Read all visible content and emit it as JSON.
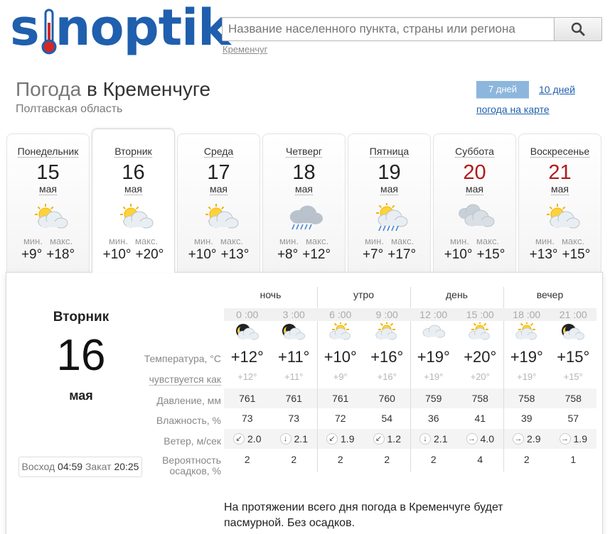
{
  "logo": {
    "text": "sinoptik"
  },
  "search": {
    "placeholder": "Название населенного пункта, страны или региона",
    "recent": "Кременчуг"
  },
  "title": {
    "prefix": "Погода",
    "city": "в Кременчуге",
    "region": "Полтавская область"
  },
  "view_tabs": {
    "seven_days": "7 дней",
    "ten_days": "10 дней",
    "map": "погода на карте"
  },
  "min_label": "мин.",
  "max_label": "макс.",
  "days": [
    {
      "name": "Понедельник",
      "date": "15",
      "month": "мая",
      "min": "+9°",
      "max": "+18°",
      "icon": "partly-cloudy-icon",
      "weekend": false,
      "active": false
    },
    {
      "name": "Вторник",
      "date": "16",
      "month": "мая",
      "min": "+10°",
      "max": "+20°",
      "icon": "partly-cloudy-icon",
      "weekend": false,
      "active": true
    },
    {
      "name": "Среда",
      "date": "17",
      "month": "мая",
      "min": "+10°",
      "max": "+13°",
      "icon": "partly-cloudy-icon",
      "weekend": false,
      "active": false
    },
    {
      "name": "Четверг",
      "date": "18",
      "month": "мая",
      "min": "+8°",
      "max": "+12°",
      "icon": "rain-icon",
      "weekend": false,
      "active": false
    },
    {
      "name": "Пятница",
      "date": "19",
      "month": "мая",
      "min": "+7°",
      "max": "+17°",
      "icon": "sun-rain-icon",
      "weekend": false,
      "active": false
    },
    {
      "name": "Суббота",
      "date": "20",
      "month": "мая",
      "min": "+10°",
      "max": "+15°",
      "icon": "cloudy-icon",
      "weekend": true,
      "active": false
    },
    {
      "name": "Воскресенье",
      "date": "21",
      "month": "мая",
      "min": "+13°",
      "max": "+15°",
      "icon": "partly-cloudy-icon",
      "weekend": true,
      "active": false
    }
  ],
  "detail": {
    "day_name": "Вторник",
    "day_num": "16",
    "month": "мая",
    "sunrise_label": "Восход",
    "sunrise": "04:59",
    "sunset_label": "Закат",
    "sunset": "20:25",
    "periods": [
      "ночь",
      "утро",
      "день",
      "вечер"
    ],
    "times": [
      "0 :00",
      "3 :00",
      "6 :00",
      "9 :00",
      "12 :00",
      "15 :00",
      "18 :00",
      "21 :00"
    ],
    "icons": [
      "moon-cloud-icon",
      "moon-cloud-icon",
      "sun-cloud-icon",
      "sun-cloud-icon",
      "cloud-icon",
      "sun-cloud-icon",
      "sun-cloud-icon",
      "moon-cloud-icon"
    ],
    "labels": {
      "temperature": "Температура, °C",
      "feels": "чувствуется как",
      "pressure": "Давление, мм",
      "humidity": "Влажность, %",
      "wind": "Ветер, м/сек",
      "precip_1": "Вероятность",
      "precip_2": "осадков, %"
    },
    "temperature": [
      "+12°",
      "+11°",
      "+10°",
      "+16°",
      "+19°",
      "+20°",
      "+19°",
      "+15°"
    ],
    "feels": [
      "+12°",
      "+11°",
      "+9°",
      "+16°",
      "+19°",
      "+20°",
      "+19°",
      "+15°"
    ],
    "pressure": [
      "761",
      "761",
      "761",
      "760",
      "759",
      "758",
      "758",
      "758"
    ],
    "humidity": [
      "73",
      "73",
      "72",
      "54",
      "36",
      "41",
      "39",
      "57"
    ],
    "wind_dir": [
      "↙",
      "↓",
      "↙",
      "↙",
      "↓",
      "→",
      "→",
      "→"
    ],
    "wind": [
      "2.0",
      "2.1",
      "1.9",
      "1.2",
      "2.1",
      "4.0",
      "2.9",
      "1.9"
    ],
    "precip": [
      "2",
      "2",
      "2",
      "2",
      "2",
      "4",
      "2",
      "1"
    ],
    "description": "На протяжении всего дня погода в Кременчуге будет пасмурной. Без осадков."
  },
  "colors": {
    "brand": "#1f5fae",
    "weekend": "#b01b1b",
    "tab_active": "#8db6dd"
  }
}
